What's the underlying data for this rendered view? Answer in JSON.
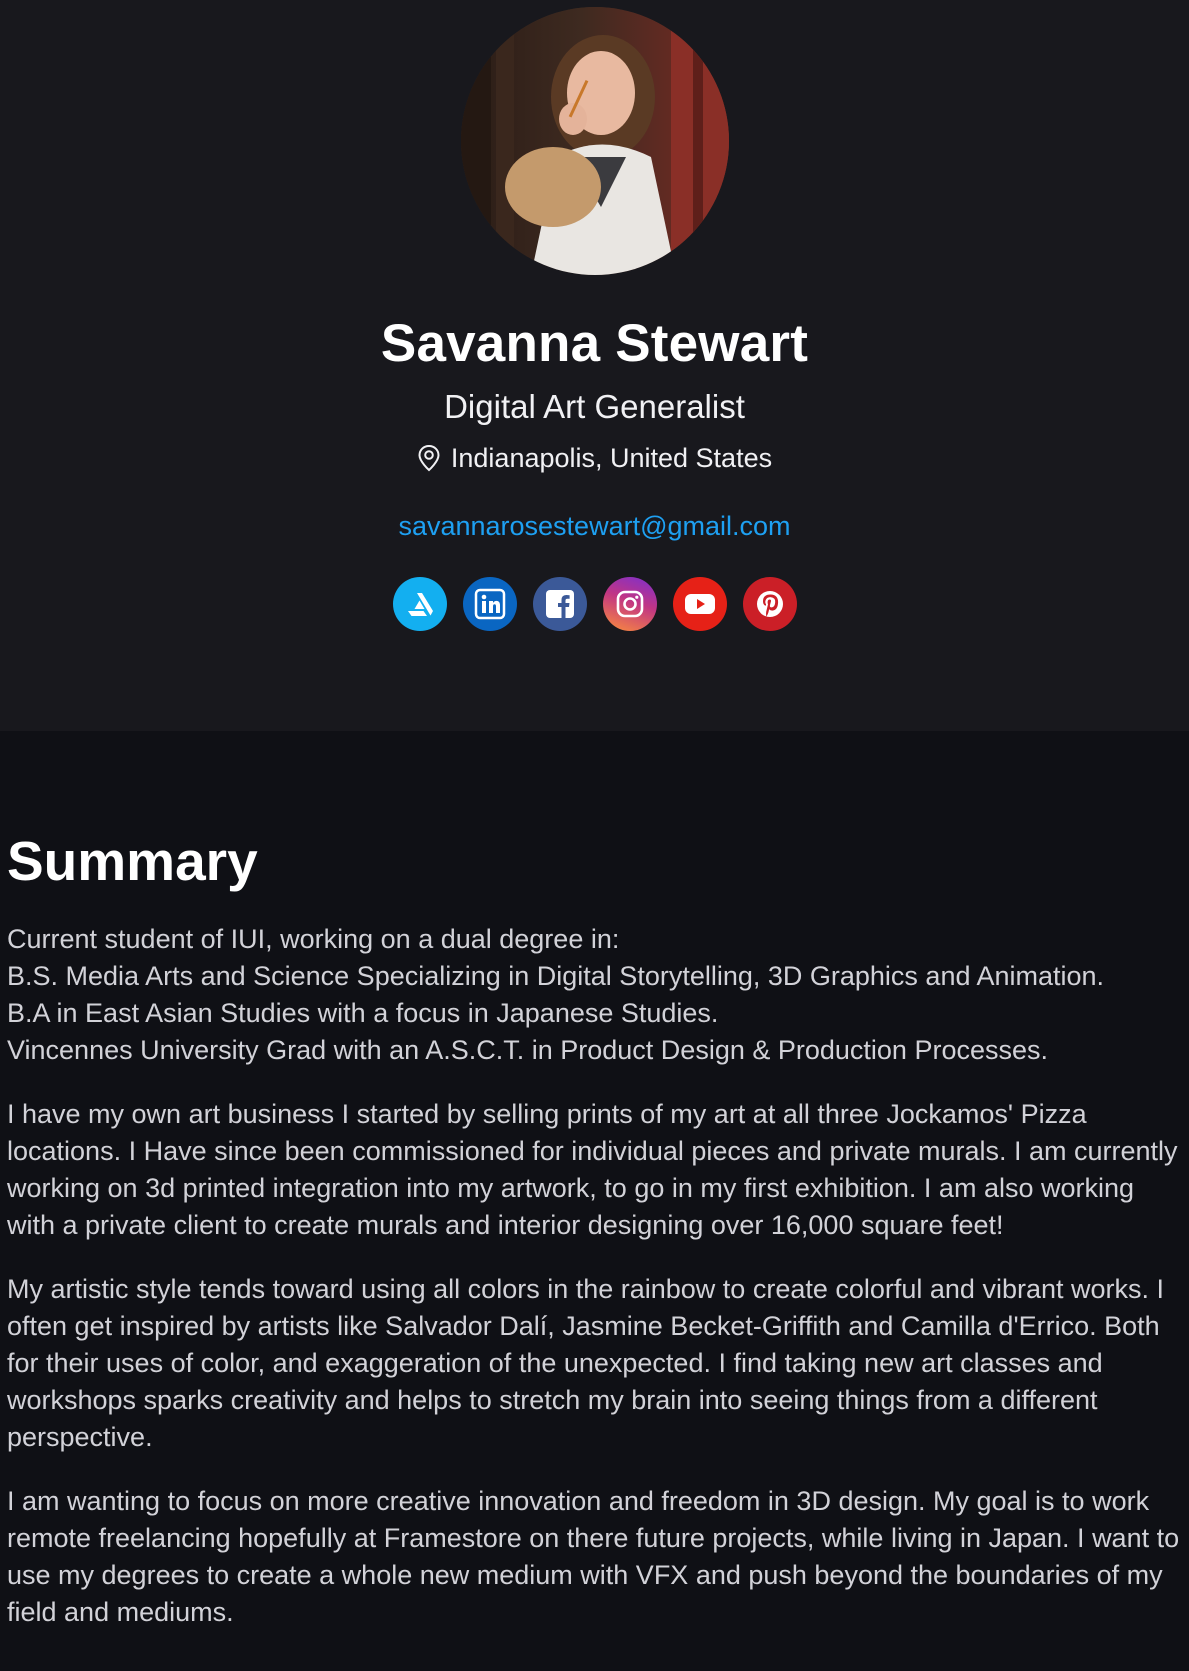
{
  "profile": {
    "name": "Savanna Stewart",
    "role": "Digital Art Generalist",
    "location": "Indianapolis, United States",
    "email": "savannarosestewart@gmail.com",
    "avatar_icon": "profile-photo"
  },
  "socials": [
    {
      "name": "artstation",
      "icon": "artstation-icon",
      "color": "#13aff0"
    },
    {
      "name": "linkedin",
      "icon": "linkedin-icon",
      "color": "#0a66c2"
    },
    {
      "name": "facebook",
      "icon": "facebook-icon",
      "color": "#3b5998"
    },
    {
      "name": "instagram",
      "icon": "instagram-icon",
      "color": "#c13584"
    },
    {
      "name": "youtube",
      "icon": "youtube-icon",
      "color": "#e62117"
    },
    {
      "name": "pinterest",
      "icon": "pinterest-icon",
      "color": "#cb1f27"
    }
  ],
  "summary": {
    "heading": "Summary",
    "intro_lines": [
      "Current student of IUI, working on a dual degree in:",
      "B.S. Media Arts and Science Specializing in Digital Storytelling, 3D Graphics and Animation.",
      "B.A in East Asian Studies with a focus in Japanese Studies.",
      "Vincennes University Grad with an A.S.C.T. in Product Design & Production Processes."
    ],
    "paragraphs": [
      "I have my own art business I started by selling prints of my art at all three Jockamos' Pizza locations. I Have since been commissioned for individual pieces and private murals. I am currently working on 3d printed integration into my artwork, to go in my first exhibition. I am also working with a private client to create murals and interior designing over 16,000 square feet!",
      "My artistic style tends toward using all colors in the rainbow to create colorful and vibrant works. I often get inspired by artists like Salvador Dalí, Jasmine Becket-Griffith and Camilla d'Errico. Both for their uses of color, and exaggeration of the unexpected. I find taking new art classes and workshops sparks creativity and helps to stretch my brain into seeing things from a different perspective.",
      "I am wanting to focus on more creative innovation and freedom in 3D design. My goal is to work remote freelancing hopefully at Framestore on there future projects, while living in Japan. I want to use my degrees to create a whole new medium with VFX and push beyond the boundaries of my field and mediums."
    ]
  }
}
